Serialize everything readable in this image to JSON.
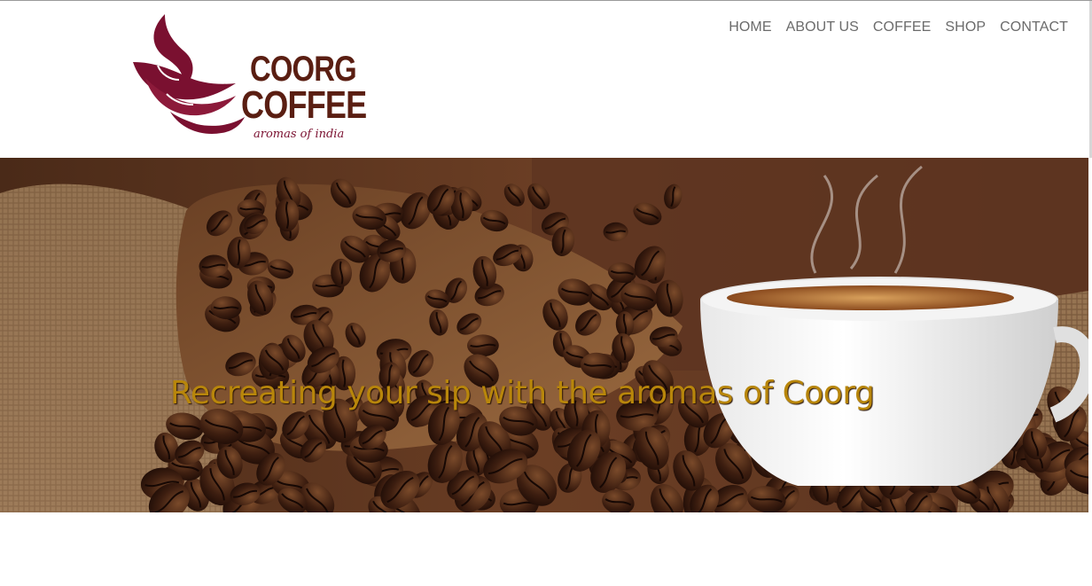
{
  "brand": {
    "line1": "COORG",
    "line2": "COFFEE",
    "tagline": "aromas of india",
    "colors": {
      "text": "#5a1e12",
      "mark": "#7a1030"
    }
  },
  "nav": {
    "items": [
      {
        "label": "HOME",
        "icon": ""
      },
      {
        "label": "ABOUT US",
        "icon": ""
      },
      {
        "label": "COFFEE",
        "icon": ""
      },
      {
        "label": "SHOP",
        "icon": ""
      },
      {
        "label": "CONTACT",
        "icon": ""
      }
    ]
  },
  "hero": {
    "caption": "Recreating your sip with the aromas of Coorg",
    "caption_color": "#b8860b",
    "image": "coffee-beans-and-cup-photo"
  }
}
